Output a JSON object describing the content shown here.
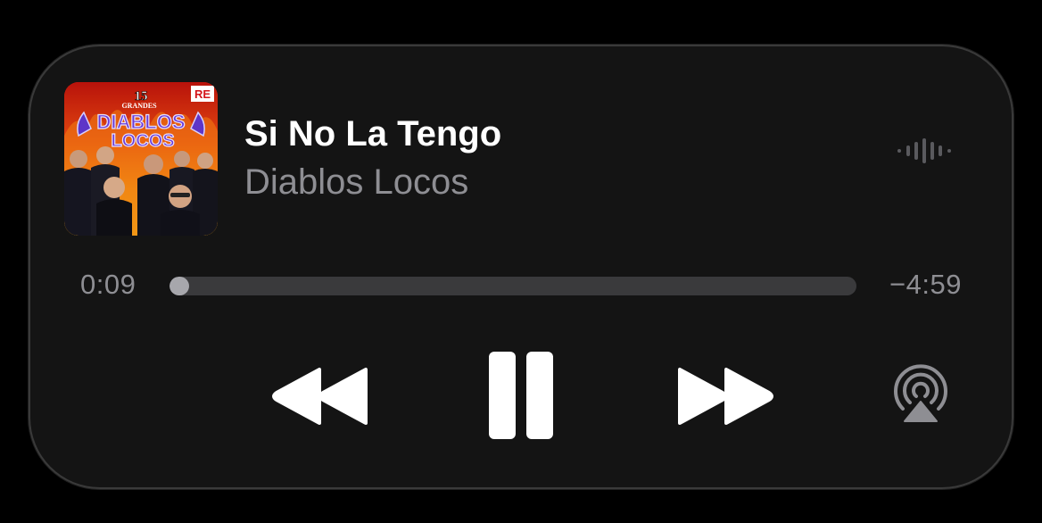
{
  "track": {
    "title": "Si No La Tengo",
    "artist": "Diablos Locos"
  },
  "artwork": {
    "top_text": "15",
    "sub_text": "GRANDES",
    "band_text_1": "DIABLOS",
    "band_text_2": "LOCOS",
    "label_text": "RE"
  },
  "playback": {
    "elapsed": "0:09",
    "remaining": "−4:59",
    "progress_fraction": 0.028,
    "state": "playing"
  },
  "icons": {
    "waveform": "waveform-icon",
    "rewind": "rewind-icon",
    "pause": "pause-icon",
    "forward": "fast-forward-icon",
    "airplay": "airplay-icon"
  },
  "colors": {
    "background": "#000000",
    "panel": "#141414",
    "primary_text": "#ffffff",
    "secondary_text": "#8e8e93",
    "track": "#3a3a3c",
    "fill": "#a7a7ac"
  }
}
